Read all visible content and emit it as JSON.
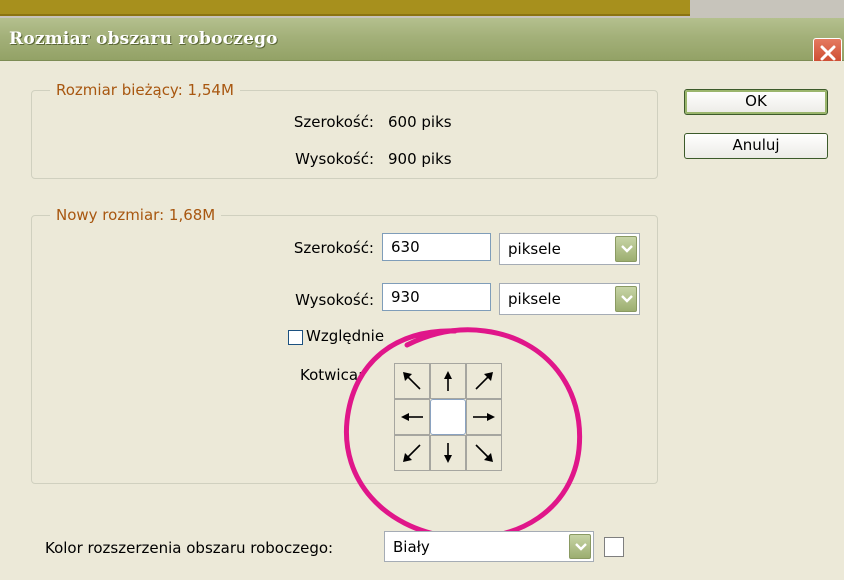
{
  "dialog": {
    "title": "Rozmiar obszaru roboczego"
  },
  "current_size": {
    "legend": "Rozmiar bieżący: 1,54M",
    "width_label": "Szerokość:",
    "width_value": "600 piks",
    "height_label": "Wysokość:",
    "height_value": "900 piks"
  },
  "new_size": {
    "legend": "Nowy rozmiar: 1,68M",
    "width_label": "Szerokość:",
    "width_value": "630",
    "width_unit": "piksele",
    "height_label": "Wysokość:",
    "height_value": "930",
    "height_unit": "piksele",
    "relative_label": "Względnie",
    "relative_checked": false,
    "anchor_label": "Kotwica:"
  },
  "buttons": {
    "ok": "OK",
    "cancel": "Anuluj"
  },
  "extension_color": {
    "label": "Kolor rozszerzenia obszaru roboczego:",
    "value": "Biały",
    "swatch_color": "#ffffff"
  },
  "colors": {
    "legend_text": "#a85710",
    "annotation": "#e0168a"
  },
  "icons": {
    "close": "close-icon",
    "dropdown": "chevron-down-icon",
    "anchor": [
      "arrow-up-left-icon",
      "arrow-up-icon",
      "arrow-up-right-icon",
      "arrow-left-icon",
      "anchor-center",
      "arrow-right-icon",
      "arrow-down-left-icon",
      "arrow-down-icon",
      "arrow-down-right-icon"
    ]
  }
}
